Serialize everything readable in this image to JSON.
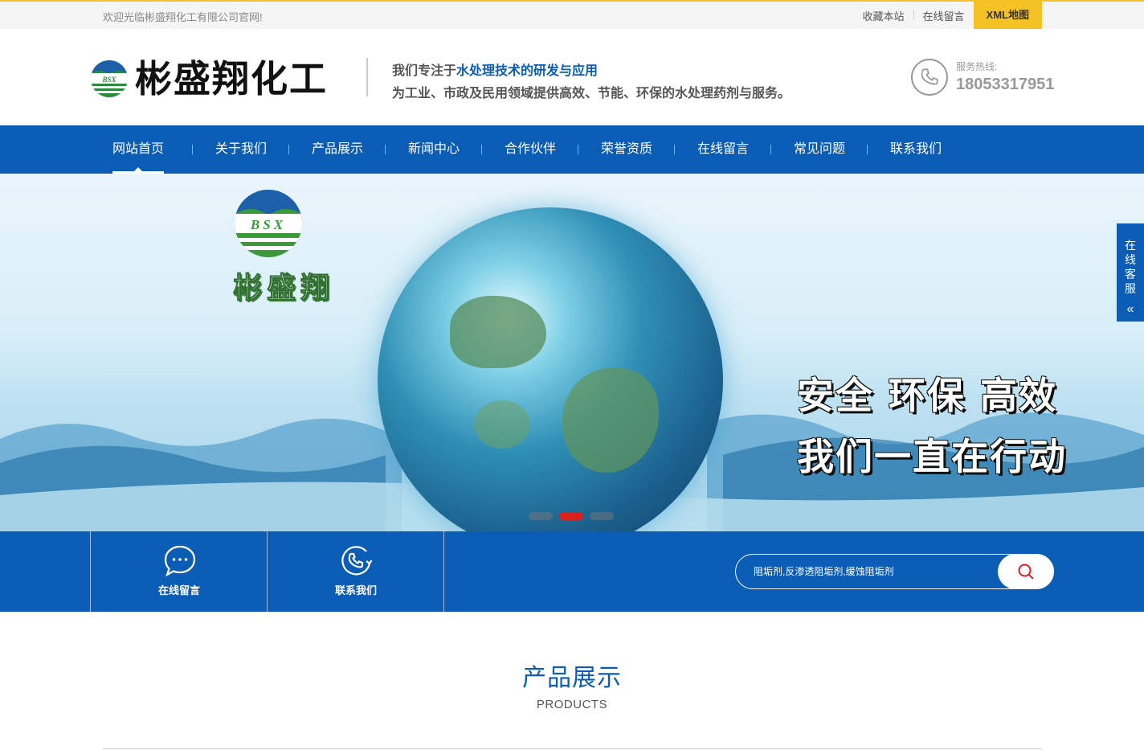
{
  "topbar": {
    "welcome": "欢迎光临彬盛翔化工有限公司官网!",
    "bookmark": "收藏本站",
    "message": "在线留言",
    "xml_map": "XML地图"
  },
  "header": {
    "logo_text": "彬盛翔化工",
    "logo_letters": "BSX",
    "slogan_prefix": "我们专注于",
    "slogan_highlight": "水处理技术的研发与应用",
    "slogan_line2": "为工业、市政及民用领域提供高效、节能、环保的水处理药剂与服务。",
    "hotline_label": "服务热线:",
    "hotline_number": "18053317951"
  },
  "nav": {
    "items": [
      {
        "label": "网站首页"
      },
      {
        "label": "关于我们"
      },
      {
        "label": "产品展示"
      },
      {
        "label": "新闻中心"
      },
      {
        "label": "合作伙伴"
      },
      {
        "label": "荣誉资质"
      },
      {
        "label": "在线留言"
      },
      {
        "label": "常见问题"
      },
      {
        "label": "联系我们"
      }
    ],
    "active_index": 0
  },
  "banner": {
    "logo_name": "彬盛翔",
    "line1": "安全 环保 高效",
    "line2": "我们一直在行动",
    "slides": 3,
    "active_slide": 2
  },
  "service_tab": {
    "label": "在线客服",
    "icon": "double-chevron-left-icon"
  },
  "quickbar": {
    "message_label": "在线留言",
    "contact_label": "联系我们",
    "search_placeholder": "阻垢剂,反渗透阻垢剂,缓蚀阻垢剂"
  },
  "products": {
    "title": "产品展示",
    "subtitle": "PRODUCTS"
  },
  "colors": {
    "primary": "#0b5cb4",
    "accent": "#f5c225",
    "active_dot": "#d9201d"
  }
}
